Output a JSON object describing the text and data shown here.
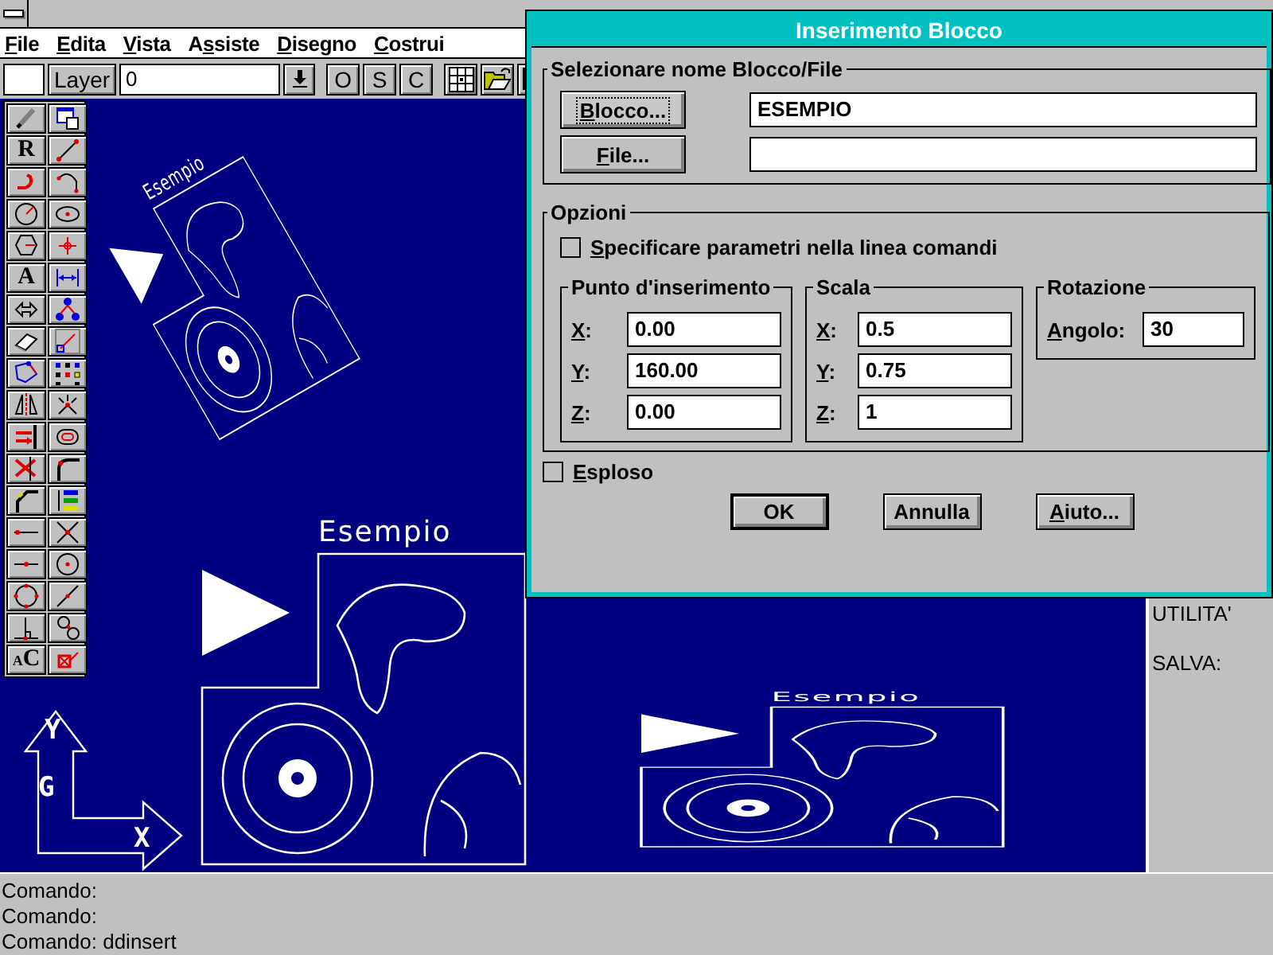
{
  "app": {
    "menu": [
      {
        "key": "F",
        "rest": "ile"
      },
      {
        "key": "E",
        "rest": "dita"
      },
      {
        "key": "V",
        "rest": "ista"
      },
      {
        "pre": "A",
        "key": "s",
        "rest": "siste"
      },
      {
        "key": "D",
        "rest": "isegno"
      },
      {
        "key": "C",
        "rest": "ostrui"
      }
    ],
    "toolbar": {
      "layer_button": "Layer",
      "layer_field": "0",
      "snap_buttons": [
        "O",
        "S",
        "C"
      ]
    },
    "toolbox": [
      {
        "kind": "icon"
      },
      {
        "kind": "icon"
      },
      {
        "kind": "letter",
        "label": "R"
      },
      {
        "kind": "icon"
      },
      {
        "kind": "icon"
      },
      {
        "kind": "icon"
      },
      {
        "kind": "icon"
      },
      {
        "kind": "icon"
      },
      {
        "kind": "icon"
      },
      {
        "kind": "icon"
      },
      {
        "kind": "letter",
        "label": "A"
      },
      {
        "kind": "icon"
      },
      {
        "kind": "icon"
      },
      {
        "kind": "icon"
      },
      {
        "kind": "icon"
      },
      {
        "kind": "icon"
      },
      {
        "kind": "icon"
      },
      {
        "kind": "icon"
      },
      {
        "kind": "icon"
      },
      {
        "kind": "icon"
      },
      {
        "kind": "icon"
      },
      {
        "kind": "icon"
      },
      {
        "kind": "icon"
      },
      {
        "kind": "icon"
      },
      {
        "kind": "icon"
      },
      {
        "kind": "icon"
      },
      {
        "kind": "icon"
      },
      {
        "kind": "icon"
      },
      {
        "kind": "icon"
      },
      {
        "kind": "icon"
      },
      {
        "kind": "icon"
      },
      {
        "kind": "icon"
      },
      {
        "kind": "icon"
      },
      {
        "kind": "icon"
      },
      {
        "kind": "pair",
        "small": "A",
        "label": "C"
      },
      {
        "kind": "icon"
      }
    ],
    "drawing": {
      "blocks": [
        {
          "label": "Esempio"
        },
        {
          "label": "Esempio"
        },
        {
          "label": "Esempio"
        }
      ],
      "ucs": {
        "y": "Y",
        "g": "G",
        "x": "X"
      }
    },
    "side_menu": [
      "UTILITA'",
      "SALVA:"
    ],
    "command_lines": [
      "Comando:",
      "Comando:",
      "Comando: ddinsert"
    ]
  },
  "dialog": {
    "title": "Inserimento Blocco",
    "name_group": {
      "title": "Selezionare nome Blocco/File",
      "rows": [
        {
          "button": {
            "key": "B",
            "rest": "locco..."
          },
          "focused": true,
          "value": "ESEMPIO"
        },
        {
          "button": {
            "key": "F",
            "rest": "ile..."
          },
          "focused": false
        }
      ]
    },
    "options": {
      "title": "Opzioni",
      "param_check": {
        "label": {
          "key": "S",
          "rest": "pecificare parametri nella linea comandi"
        },
        "checked": false
      },
      "insertion": {
        "title": "Punto d'inserimento",
        "fields": [
          {
            "label": {
              "key": "X",
              "rest": ":"
            },
            "value": "0.00"
          },
          {
            "label": {
              "key": "Y",
              "rest": ":"
            },
            "value": "160.00"
          },
          {
            "label": {
              "key": "Z",
              "rest": ":"
            },
            "value": "0.00"
          }
        ]
      },
      "scale": {
        "title": "Scala",
        "fields": [
          {
            "label": {
              "key": "X",
              "rest": ":"
            },
            "value": "0.5"
          },
          {
            "label": {
              "key": "Y",
              "rest": ":"
            },
            "value": "0.75"
          },
          {
            "label": {
              "key": "Z",
              "rest": ":"
            },
            "value": "1"
          }
        ]
      },
      "rotation": {
        "title": "Rotazione",
        "field": {
          "label": {
            "key": "A",
            "rest": "ngolo:"
          },
          "value": "30"
        }
      }
    },
    "explode_check": {
      "label": {
        "key": "E",
        "rest": "sploso"
      },
      "checked": false
    },
    "buttons": [
      {
        "label": {
          "rest": "OK"
        },
        "default": true
      },
      {
        "label": {
          "rest": "Annulla"
        },
        "default": false
      },
      {
        "label": {
          "key": "A",
          "rest": "iuto..."
        },
        "default": false
      }
    ]
  }
}
